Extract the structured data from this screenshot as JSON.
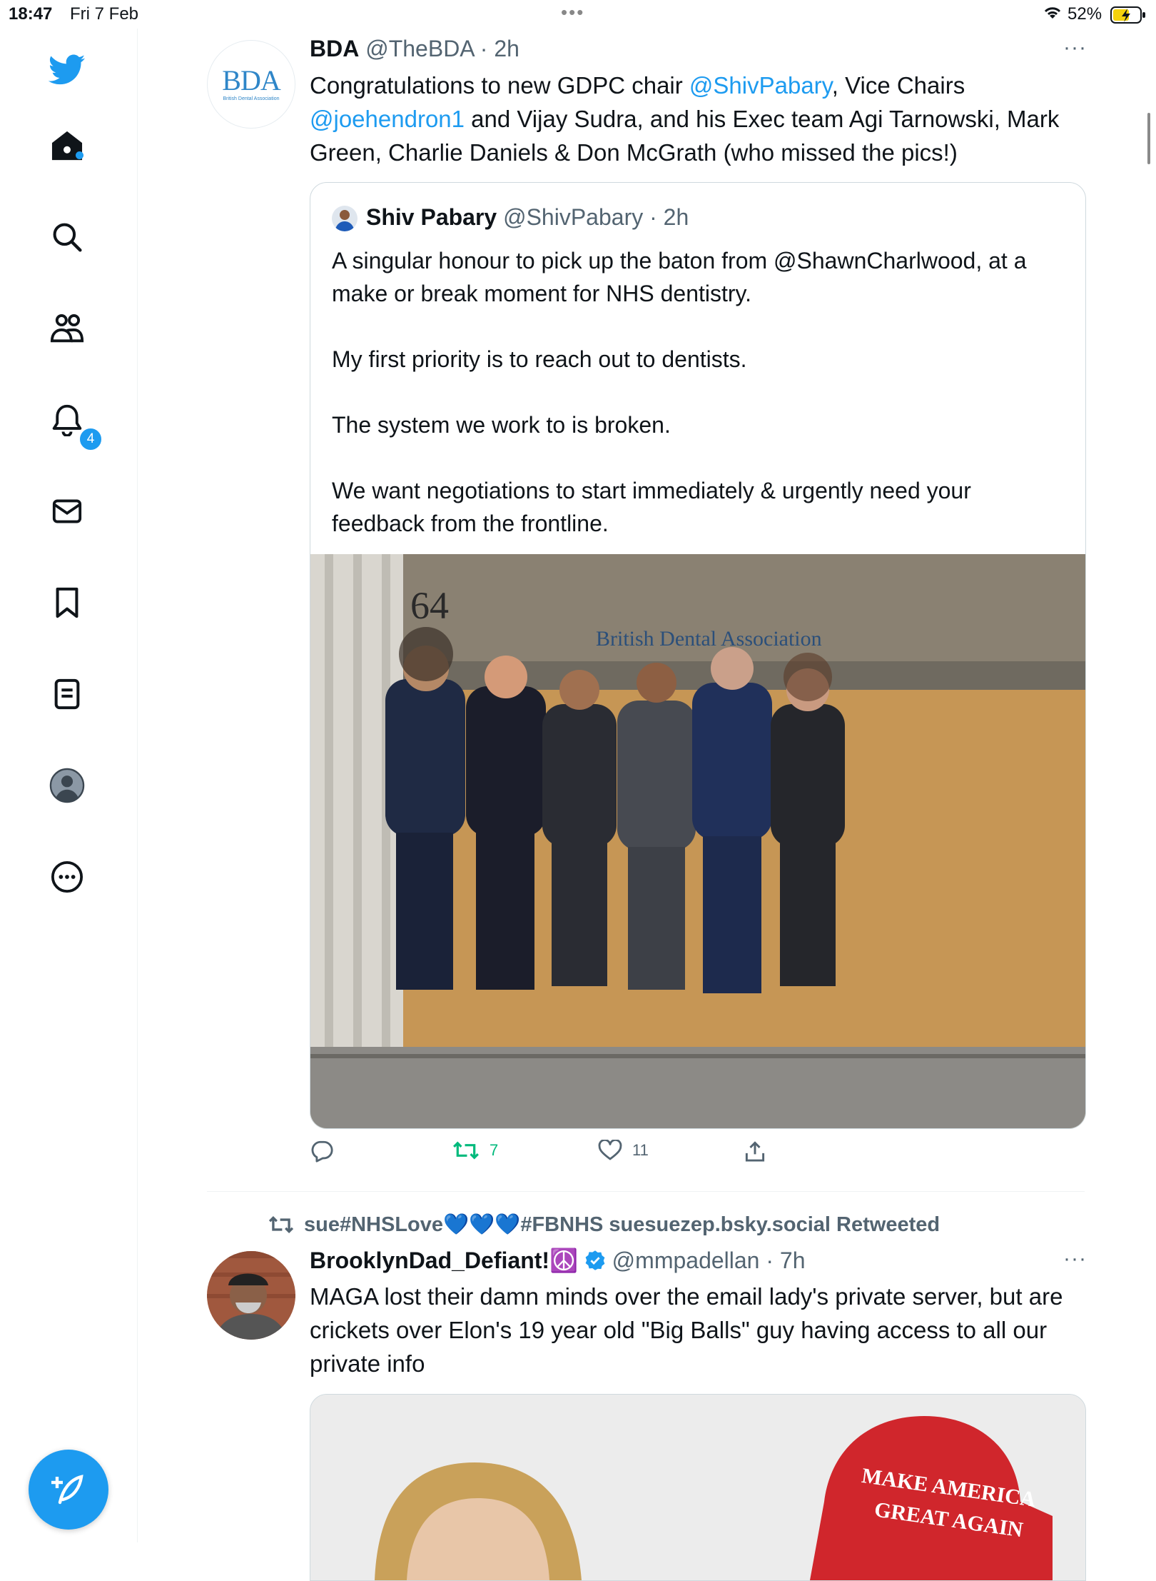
{
  "status_bar": {
    "time": "18:47",
    "date": "Fri 7 Feb",
    "battery": "52%"
  },
  "sidebar": {
    "items": [
      {
        "name": "twitter-logo-icon"
      },
      {
        "name": "home-icon"
      },
      {
        "name": "search-icon"
      },
      {
        "name": "communities-icon"
      },
      {
        "name": "notifications-icon"
      },
      {
        "name": "messages-icon"
      },
      {
        "name": "bookmarks-icon"
      },
      {
        "name": "lists-icon"
      },
      {
        "name": "profile-icon"
      },
      {
        "name": "more-icon"
      }
    ],
    "notification_count": "4"
  },
  "tweet1": {
    "avatar_text": "BDA",
    "avatar_subtext": "British Dental Association",
    "name": "BDA",
    "handle": "@TheBDA",
    "time": "· 2h",
    "text_parts": {
      "t1": "Congratulations to new GDPC chair ",
      "m1": "@ShivPabary",
      "t2": ", Vice Chairs",
      "m2": "@joehendron1",
      "t3": " and Vijay Sudra, and his Exec team Agi Tarnowski, Mark Green, Charlie Daniels & Don McGrath (who missed the pics!)"
    },
    "quote": {
      "name": "Shiv Pabary",
      "handle": "@ShivPabary",
      "time": "· 2h",
      "p1": "A singular honour to pick up the baton from @ShawnCharlwood, at a make or break moment for NHS dentistry.",
      "p2": "My first priority is to reach out to dentists.",
      "p3": "The system we work to is broken.",
      "p4": "We want negotiations to start immediately & urgently need your feedback from the frontline.",
      "photo_sign_number": "64",
      "photo_sign_text": "British Dental Association"
    },
    "actions": {
      "reply": "",
      "retweets": "7",
      "likes": "11"
    }
  },
  "tweet2": {
    "retweeted_by": "sue#NHSLove💙💙💙#FBNHS suesuezep.bsky.social Retweeted",
    "name": "BrooklynDad_Defiant!☮️",
    "handle": "@mmpadellan",
    "time": "· 7h",
    "text": "MAGA lost their damn minds over the email lady's private server, but are crickets over Elon's 19 year old \"Big Balls\" guy having access to all our private info",
    "hat_text_line1": "MAKE AMERICA",
    "hat_text_line2": "GREAT AGAIN"
  },
  "colors": {
    "accent": "#1d9bf0",
    "retweet_green": "#00ba7c",
    "muted": "#536471"
  }
}
